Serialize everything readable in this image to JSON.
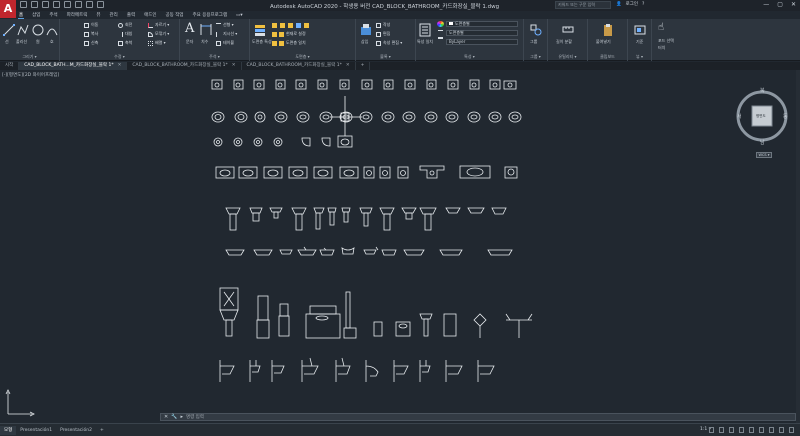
{
  "app": {
    "logo": "A",
    "title": "Autodesk AutoCAD 2020 - 학생용 버전    CAD_BLOCK_BATHROOM_카드화장실_블락 1.dwg",
    "search_placeholder": "키워드 또는 구문 입력",
    "login_label": "로그인",
    "window_controls": [
      "—",
      "▢",
      "✕"
    ]
  },
  "ribbon_tabs": [
    {
      "label": "홈",
      "active": true
    },
    {
      "label": "삽입",
      "active": false
    },
    {
      "label": "주석",
      "active": false
    },
    {
      "label": "파라메트릭",
      "active": false
    },
    {
      "label": "뷰",
      "active": false
    },
    {
      "label": "관리",
      "active": false
    },
    {
      "label": "출력",
      "active": false
    },
    {
      "label": "애드인",
      "active": false
    },
    {
      "label": "공동 작업",
      "active": false
    },
    {
      "label": "주요 응용프로그램",
      "active": false
    },
    {
      "label": "▭▾",
      "active": false
    }
  ],
  "ribbon": {
    "draw": {
      "title": "그리기 ▾",
      "line": "선",
      "polyline": "폴리선",
      "circle": "원",
      "arc": "호"
    },
    "modify": {
      "title": "수정 ▾",
      "items": [
        "이동",
        "회전",
        "자르기 ▾",
        "복사",
        "대칭",
        "모깎기 ▾",
        "신축",
        "축척",
        "배열 ▾"
      ]
    },
    "annotation": {
      "title": "주석 ▾",
      "text": "문자",
      "dimension": "치수",
      "items": [
        "선형 ▾",
        "지시선 ▾",
        "테이블"
      ]
    },
    "layers": {
      "title": "도면층 ▾",
      "layer_props": "도면층 특성",
      "items": [
        "현재로 설정",
        "도면층 일치"
      ]
    },
    "block": {
      "title": "블록 ▾",
      "insert": "삽입",
      "items": [
        "작성",
        "편집",
        "속성 편집 ▾"
      ]
    },
    "properties": {
      "title": "특성 ▾",
      "match": "특성 일치",
      "layer_value": "도면층별",
      "linetype_value": "도면층별",
      "lineweight_value": "ByLayer"
    },
    "groups": {
      "title": "그룹 ▾",
      "label": "그룹"
    },
    "utilities": {
      "title": "유틸리티 ▾",
      "measure": "길이 분할"
    },
    "clipboard": {
      "title": "클립보드",
      "paste": "붙여넣기"
    },
    "view": {
      "title": "뷰 ▾",
      "base": "기준"
    },
    "touch": {
      "title": "",
      "select": "포드 선택",
      "mode": "터치"
    }
  },
  "doc_tabs": [
    {
      "label": "시작",
      "active": false,
      "close": ""
    },
    {
      "label": "CAD_BLOCK_BATH...M_카드화장실_블락 1*",
      "active": true,
      "close": "✕"
    },
    {
      "label": "CAD_BLOCK_BATHROOM_카드화장실_블락 1*",
      "active": false,
      "close": "✕"
    },
    {
      "label": "CAD_BLOCK_BATHROOM_카드화장실_블락 1*",
      "active": false,
      "close": "✕"
    },
    {
      "label": "+",
      "active": false,
      "close": ""
    }
  ],
  "viewport": {
    "label": "[-][평면도][2D 와이어프레임]"
  },
  "viewcube": {
    "north": "북",
    "south": "남",
    "west": "서",
    "east": "동",
    "face": "평면도",
    "wcs": "WCS ▾"
  },
  "command": {
    "placeholder": "명령 입력"
  },
  "layout_tabs": [
    {
      "label": "모형",
      "active": true
    },
    {
      "label": "Presentación1",
      "active": false
    },
    {
      "label": "Presentación2",
      "active": false
    },
    {
      "label": "+",
      "active": false
    }
  ],
  "status": {
    "scale": "1:1 ▾"
  },
  "colors": {
    "canvas": "#212830",
    "ribbon": "#2d353e",
    "accent": "#c0262d"
  }
}
